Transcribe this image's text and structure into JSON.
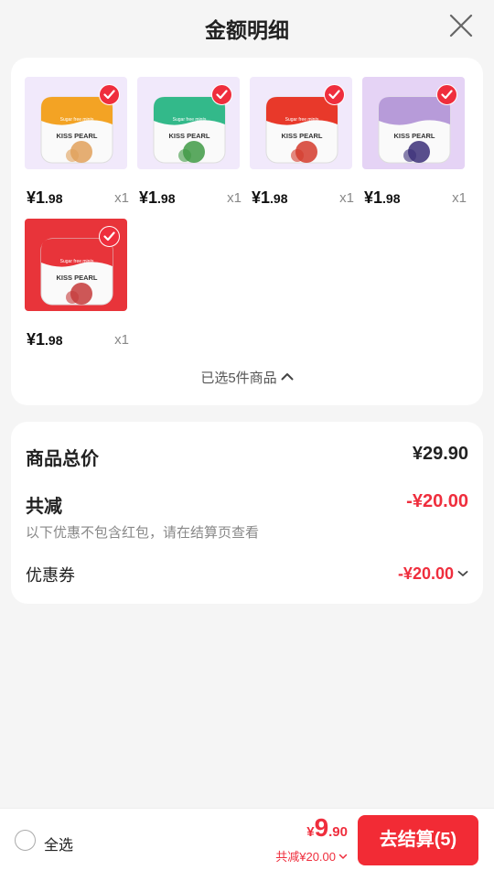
{
  "header": {
    "title": "金额明细"
  },
  "products": [
    {
      "brand": "KISS PEARL",
      "tagline": "Sugar free mints",
      "price_main": "¥1",
      "price_decimal": ".98",
      "qty": "x1",
      "lid_color": "#f3a324",
      "bg_color": "#f1e9fb",
      "fruit_color": "#e0a05a"
    },
    {
      "brand": "KISS PEARL",
      "tagline": "Sugar free mints",
      "price_main": "¥1",
      "price_decimal": ".98",
      "qty": "x1",
      "lid_color": "#33b98a",
      "bg_color": "#f1e9fb",
      "fruit_color": "#3f9a45"
    },
    {
      "brand": "KISS PEARL",
      "tagline": "Sugar free mints",
      "price_main": "¥1",
      "price_decimal": ".98",
      "qty": "x1",
      "lid_color": "#e8392a",
      "bg_color": "#f1e9fb",
      "fruit_color": "#d33a2b"
    },
    {
      "brand": "KISS PEARL",
      "tagline": "",
      "price_main": "¥1",
      "price_decimal": ".98",
      "qty": "x1",
      "lid_color": "#b79bd9",
      "bg_color": "#e5d3f5",
      "fruit_color": "#3b2f78"
    },
    {
      "brand": "KISS PEARL",
      "tagline": "Sugar free mints",
      "price_main": "¥1",
      "price_decimal": ".98",
      "qty": "x1",
      "lid_color": "#e8343a",
      "bg_color": "#e8343a",
      "fruit_color": "#c43a3a"
    }
  ],
  "selected_summary": "已选5件商品",
  "summary": {
    "total_label": "商品总价",
    "total_value": "¥29.90",
    "discount_label": "共减",
    "discount_value": "-¥20.00",
    "discount_note": "以下优惠不包含红包，请在结算页查看",
    "coupon_label": "优惠券",
    "coupon_value": "-¥20.00"
  },
  "footer": {
    "select_all": "全选",
    "currency": "¥",
    "total_int": "9",
    "total_dec": ".90",
    "discount_text": "共减¥20.00",
    "checkout_label": "去结算(5)"
  },
  "colors": {
    "accent": "#ef2e3d",
    "checkout_bg": "#f22b35"
  }
}
